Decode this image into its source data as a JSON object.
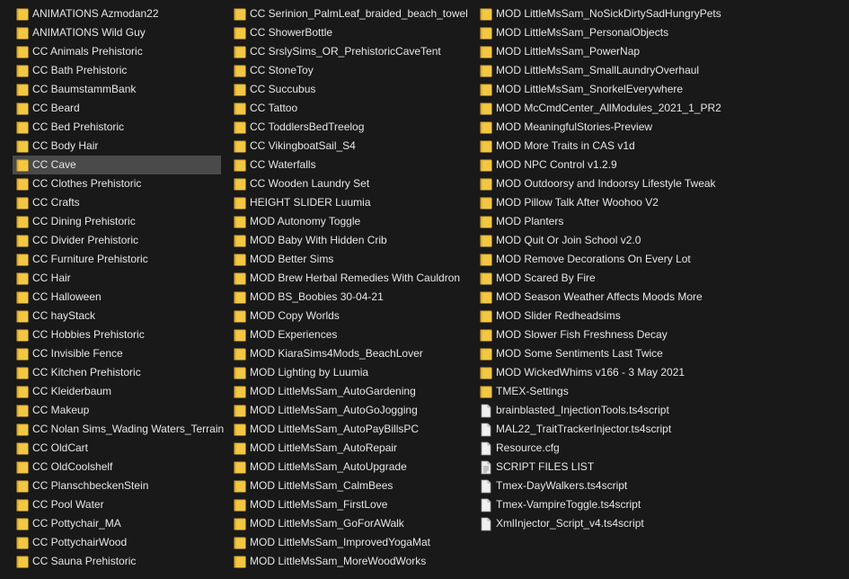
{
  "colors": {
    "background": "#191919",
    "text": "#e6e6e6",
    "selected": "#4a4a4a",
    "folder": "#f2c744",
    "folder_dark": "#d9a62a",
    "file": "#f0f0f0"
  },
  "columns": [
    {
      "items": [
        {
          "name": "ANIMATIONS Azmodan22",
          "type": "folder"
        },
        {
          "name": "ANIMATIONS Wild Guy",
          "type": "folder"
        },
        {
          "name": "CC Animals Prehistoric",
          "type": "folder"
        },
        {
          "name": "CC Bath Prehistoric",
          "type": "folder"
        },
        {
          "name": "CC BaumstammBank",
          "type": "folder"
        },
        {
          "name": "CC Beard",
          "type": "folder"
        },
        {
          "name": "CC Bed Prehistoric",
          "type": "folder"
        },
        {
          "name": "CC Body Hair",
          "type": "folder"
        },
        {
          "name": "CC Cave",
          "type": "folder",
          "selected": true
        },
        {
          "name": "CC Clothes Prehistoric",
          "type": "folder"
        },
        {
          "name": "CC Crafts",
          "type": "folder"
        },
        {
          "name": "CC Dining Prehistoric",
          "type": "folder"
        },
        {
          "name": "CC Divider Prehistoric",
          "type": "folder"
        },
        {
          "name": "CC Furniture Prehistoric",
          "type": "folder"
        },
        {
          "name": "CC Hair",
          "type": "folder"
        },
        {
          "name": "CC Halloween",
          "type": "folder"
        },
        {
          "name": "CC hayStack",
          "type": "folder"
        },
        {
          "name": "CC Hobbies Prehistoric",
          "type": "folder"
        },
        {
          "name": "CC Invisible Fence",
          "type": "folder"
        },
        {
          "name": "CC Kitchen Prehistoric",
          "type": "folder"
        },
        {
          "name": "CC Kleiderbaum",
          "type": "folder"
        },
        {
          "name": "CC Makeup",
          "type": "folder"
        },
        {
          "name": "CC Nolan Sims_Wading Waters_Terrain",
          "type": "folder"
        },
        {
          "name": "CC OldCart",
          "type": "folder"
        },
        {
          "name": "CC OldCoolshelf",
          "type": "folder"
        },
        {
          "name": "CC PlanschbeckenStein",
          "type": "folder"
        },
        {
          "name": "CC Pool Water",
          "type": "folder"
        },
        {
          "name": "CC Pottychair_MA",
          "type": "folder"
        },
        {
          "name": "CC PottychairWood",
          "type": "folder"
        },
        {
          "name": "CC Sauna Prehistoric",
          "type": "folder"
        }
      ]
    },
    {
      "items": [
        {
          "name": "CC Serinion_PalmLeaf_braided_beach_towel",
          "type": "folder"
        },
        {
          "name": "CC ShowerBottle",
          "type": "folder"
        },
        {
          "name": "CC SrslySims_OR_PrehistoricCaveTent",
          "type": "folder"
        },
        {
          "name": "CC StoneToy",
          "type": "folder"
        },
        {
          "name": "CC Succubus",
          "type": "folder"
        },
        {
          "name": "CC Tattoo",
          "type": "folder"
        },
        {
          "name": "CC ToddlersBedTreelog",
          "type": "folder"
        },
        {
          "name": "CC VikingboatSail_S4",
          "type": "folder"
        },
        {
          "name": "CC Waterfalls",
          "type": "folder"
        },
        {
          "name": "CC Wooden Laundry Set",
          "type": "folder"
        },
        {
          "name": "HEIGHT SLIDER Luumia",
          "type": "folder"
        },
        {
          "name": "MOD Autonomy Toggle",
          "type": "folder"
        },
        {
          "name": "MOD Baby With Hidden Crib",
          "type": "folder"
        },
        {
          "name": "MOD Better Sims",
          "type": "folder"
        },
        {
          "name": "MOD Brew Herbal Remedies With Cauldron",
          "type": "folder"
        },
        {
          "name": "MOD BS_Boobies 30-04-21",
          "type": "folder"
        },
        {
          "name": "MOD Copy Worlds",
          "type": "folder"
        },
        {
          "name": "MOD Experiences",
          "type": "folder"
        },
        {
          "name": "MOD KiaraSims4Mods_BeachLover",
          "type": "folder"
        },
        {
          "name": "MOD Lighting by Luumia",
          "type": "folder"
        },
        {
          "name": "MOD LittleMsSam_AutoGardening",
          "type": "folder"
        },
        {
          "name": "MOD LittleMsSam_AutoGoJogging",
          "type": "folder"
        },
        {
          "name": "MOD LittleMsSam_AutoPayBillsPC",
          "type": "folder"
        },
        {
          "name": "MOD LittleMsSam_AutoRepair",
          "type": "folder"
        },
        {
          "name": "MOD LittleMsSam_AutoUpgrade",
          "type": "folder"
        },
        {
          "name": "MOD LittleMsSam_CalmBees",
          "type": "folder"
        },
        {
          "name": "MOD LittleMsSam_FirstLove",
          "type": "folder"
        },
        {
          "name": "MOD LittleMsSam_GoForAWalk",
          "type": "folder"
        },
        {
          "name": "MOD LittleMsSam_ImprovedYogaMat",
          "type": "folder"
        },
        {
          "name": "MOD LittleMsSam_MoreWoodWorks",
          "type": "folder"
        }
      ]
    },
    {
      "items": [
        {
          "name": "MOD LittleMsSam_NoSickDirtySadHungryPets",
          "type": "folder"
        },
        {
          "name": "MOD LittleMsSam_PersonalObjects",
          "type": "folder"
        },
        {
          "name": "MOD LittleMsSam_PowerNap",
          "type": "folder"
        },
        {
          "name": "MOD LittleMsSam_SmallLaundryOverhaul",
          "type": "folder"
        },
        {
          "name": "MOD LittleMsSam_SnorkelEverywhere",
          "type": "folder"
        },
        {
          "name": "MOD McCmdCenter_AllModules_2021_1_PR2",
          "type": "folder"
        },
        {
          "name": "MOD MeaningfulStories-Preview",
          "type": "folder"
        },
        {
          "name": "MOD More Traits in CAS v1d",
          "type": "folder"
        },
        {
          "name": "MOD NPC Control v1.2.9",
          "type": "folder"
        },
        {
          "name": "MOD Outdoorsy and Indoorsy Lifestyle Tweak",
          "type": "folder"
        },
        {
          "name": "MOD Pillow Talk After Woohoo V2",
          "type": "folder"
        },
        {
          "name": "MOD Planters",
          "type": "folder"
        },
        {
          "name": "MOD Quit Or Join School v2.0",
          "type": "folder"
        },
        {
          "name": "MOD Remove Decorations On Every Lot",
          "type": "folder"
        },
        {
          "name": "MOD Scared By Fire",
          "type": "folder"
        },
        {
          "name": "MOD Season Weather Affects Moods More",
          "type": "folder"
        },
        {
          "name": "MOD Slider Redheadsims",
          "type": "folder"
        },
        {
          "name": "MOD Slower Fish Freshness Decay",
          "type": "folder"
        },
        {
          "name": "MOD Some Sentiments Last Twice",
          "type": "folder"
        },
        {
          "name": "MOD WickedWhims v166 - 3 May 2021",
          "type": "folder"
        },
        {
          "name": "TMEX-Settings",
          "type": "folder"
        },
        {
          "name": "brainblasted_InjectionTools.ts4script",
          "type": "file"
        },
        {
          "name": "MAL22_TraitTrackerInjector.ts4script",
          "type": "file"
        },
        {
          "name": "Resource.cfg",
          "type": "file"
        },
        {
          "name": "SCRIPT FILES LIST",
          "type": "doc"
        },
        {
          "name": "Tmex-DayWalkers.ts4script",
          "type": "file"
        },
        {
          "name": "Tmex-VampireToggle.ts4script",
          "type": "file"
        },
        {
          "name": "XmlInjector_Script_v4.ts4script",
          "type": "file"
        }
      ]
    }
  ]
}
